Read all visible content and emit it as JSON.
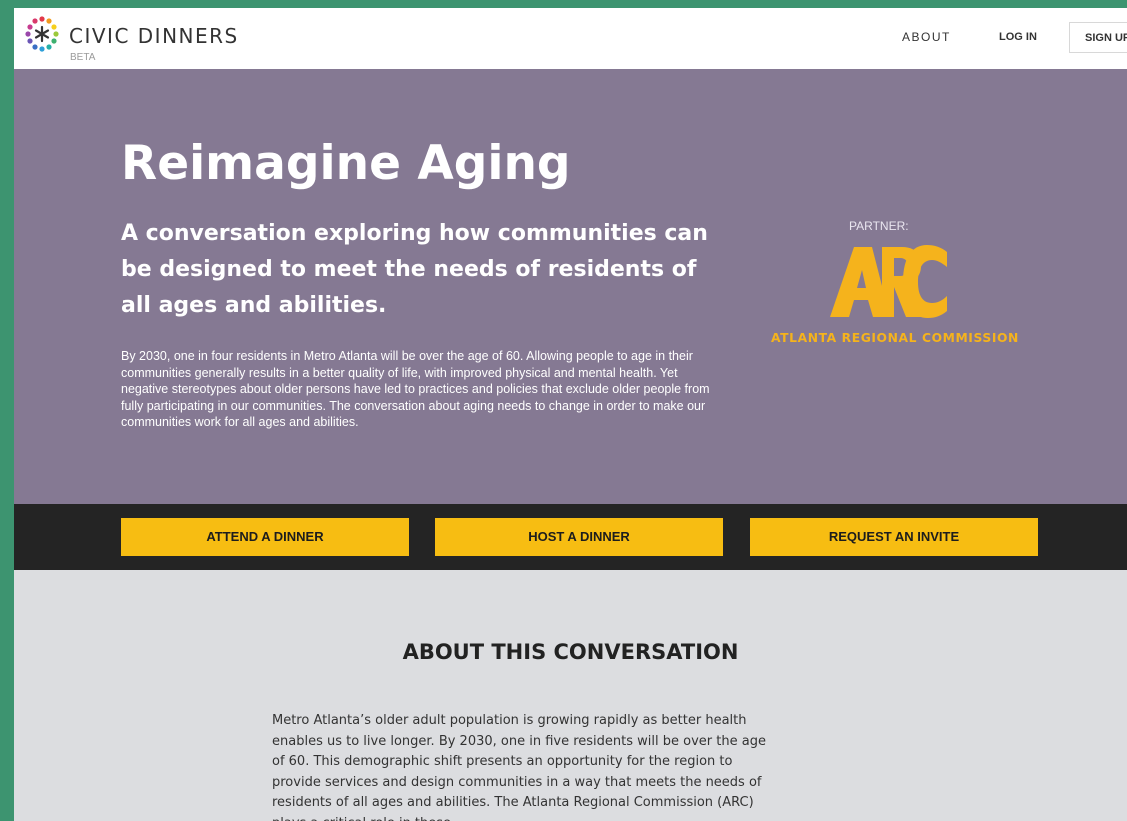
{
  "header": {
    "brand": "CIVIC DINNERS",
    "badge": "BETA",
    "nav": {
      "about": "ABOUT",
      "login": "LOG IN",
      "signup": "SIGN UP"
    }
  },
  "hero": {
    "title": "Reimagine Aging",
    "subtitle": "A conversation exploring how communities can be designed to meet the needs of residents of all ages and abilities.",
    "body": "By 2030, one in four residents in Metro Atlanta will be over the age of 60. Allowing people to age in their communities generally results in a better quality of life, with improved physical and mental health. Yet negative stereotypes about older persons have led to practices and policies that exclude older people from fully participating in our communities. The conversation about aging needs to change in order to make our communities work for all ages and abilities.",
    "partner_label": "PARTNER:",
    "partner_logo_text": "ARC",
    "partner_name": "ATLANTA REGIONAL COMMISSION"
  },
  "cta": {
    "attend": "ATTEND A DINNER",
    "host": "HOST A DINNER",
    "request": "REQUEST AN INVITE"
  },
  "about": {
    "heading": "ABOUT THIS CONVERSATION",
    "body": "Metro Atlanta’s older adult population is growing rapidly as better health enables us to live longer. By 2030, one in five residents will be over the age of 60. This demographic shift presents an opportunity for the region to provide services and design communities in a way that meets the needs of residents of all ages and abilities. The Atlanta Regional Commission (ARC) plays a critical role in these"
  },
  "colors": {
    "hero_bg": "#857993",
    "cta_bar_bg": "#242424",
    "cta_button": "#f7bd12",
    "partner_accent": "#f5b31c",
    "page_bg": "#dcdde0",
    "frame_bg": "#3d9470"
  },
  "icons": {
    "logo": "civic-dinners-asterisk-logo",
    "partner": "arc-logo"
  }
}
